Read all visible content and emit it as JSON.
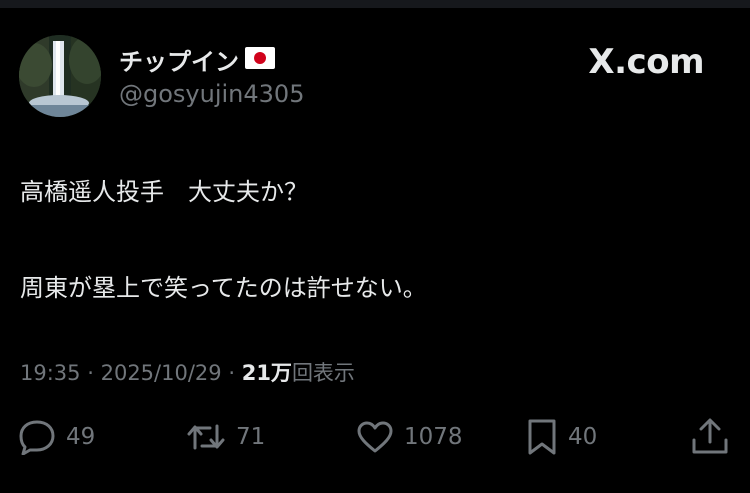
{
  "account": {
    "display_name": "チップイン",
    "handle": "@gosyujin4305"
  },
  "site_badge": "X.com",
  "tweet": {
    "line1": "高橋遥人投手　大丈夫か？",
    "line2": "周東が塁上で笑ってたのは許せない。"
  },
  "meta": {
    "time": "19:35",
    "separator": "·",
    "date": "2025/10/29",
    "views_count": "21万",
    "views_label": "回表示"
  },
  "actions": {
    "replies": "49",
    "reposts": "71",
    "likes": "1078",
    "bookmarks": "40"
  },
  "icons": {
    "reply": "reply-icon",
    "repost": "repost-icon",
    "like": "like-icon",
    "bookmark": "bookmark-icon",
    "share": "share-icon",
    "flag": "japan-flag-icon"
  },
  "colors": {
    "background": "#000000",
    "text": "#e7e9ea",
    "secondary_text": "#71767b",
    "flag_red": "#d0021b"
  }
}
